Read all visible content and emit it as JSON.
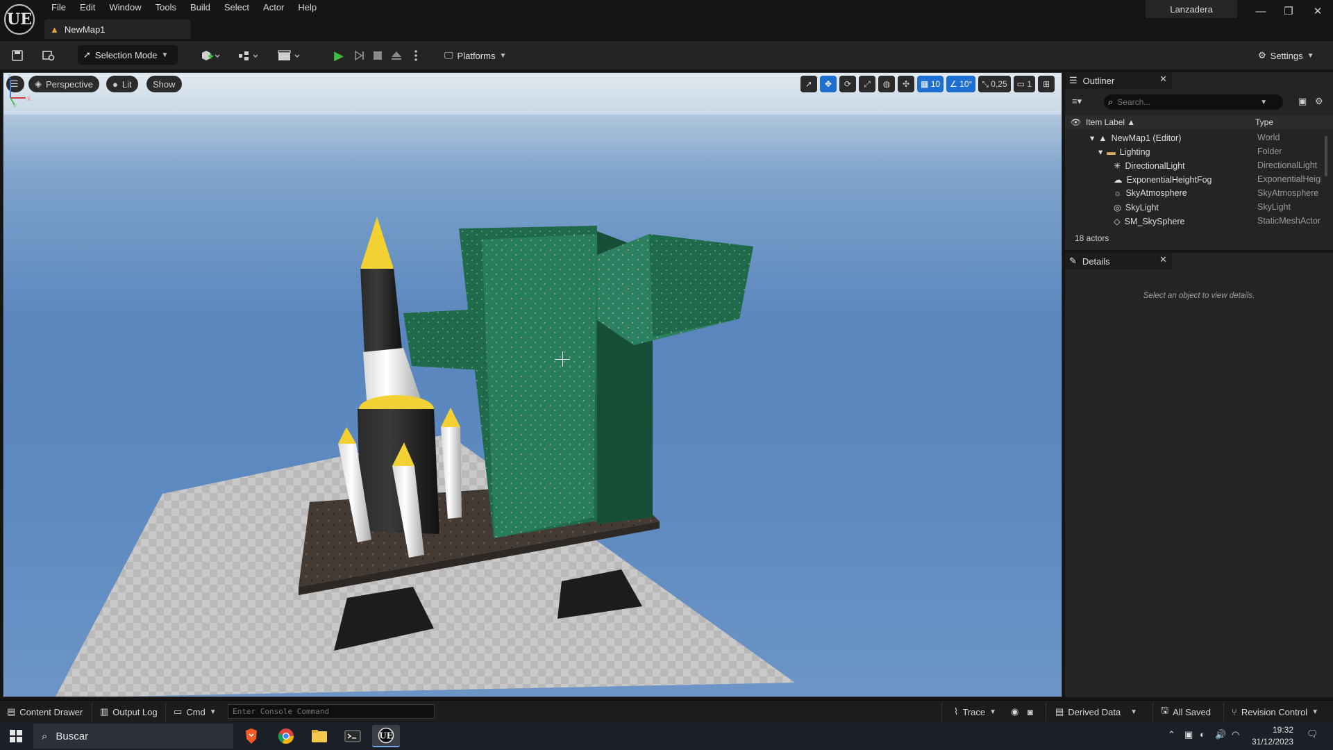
{
  "app": {
    "logo": "UE",
    "project_name": "Lanzadera",
    "window_buttons": {
      "minimize": "—",
      "restore": "❐",
      "close": "✕"
    }
  },
  "menu": [
    "File",
    "Edit",
    "Window",
    "Tools",
    "Build",
    "Select",
    "Actor",
    "Help"
  ],
  "doc_tab": {
    "label": "NewMap1"
  },
  "toolbar": {
    "selection_mode": "Selection Mode",
    "platforms": "Platforms",
    "settings": "Settings"
  },
  "viewport": {
    "perspective": "Perspective",
    "lit": "Lit",
    "show": "Show",
    "grid_snap": "10",
    "rotation_snap": "10°",
    "scale_snap": "0,25",
    "camera_speed": "1",
    "axis_labels": {
      "z": "z",
      "x": "x",
      "y": "y"
    }
  },
  "outliner": {
    "title": "Outliner",
    "search_placeholder": "Search...",
    "col_label": "Item Label ▲",
    "col_type": "Type",
    "rows": [
      {
        "label": "NewMap1 (Editor)",
        "type": "World"
      },
      {
        "label": "Lighting",
        "type": "Folder"
      },
      {
        "label": "DirectionalLight",
        "type": "DirectionalLight"
      },
      {
        "label": "ExponentialHeightFog",
        "type": "ExponentialHeightFog"
      },
      {
        "label": "SkyAtmosphere",
        "type": "SkyAtmosphere"
      },
      {
        "label": "SkyLight",
        "type": "SkyLight"
      },
      {
        "label": "SM_SkySphere",
        "type": "StaticMeshActor"
      }
    ],
    "actor_count": "18 actors"
  },
  "details": {
    "title": "Details",
    "empty_message": "Select an object to view details."
  },
  "bottombar": {
    "content_drawer": "Content Drawer",
    "output_log": "Output Log",
    "cmd": "Cmd",
    "console_placeholder": "Enter Console Command",
    "trace": "Trace",
    "derived_data": "Derived Data",
    "all_saved": "All Saved",
    "revision_control": "Revision Control"
  },
  "taskbar": {
    "search": "Buscar",
    "time": "19:32",
    "date": "31/12/2023"
  },
  "colors": {
    "accent": "#1e6fd0",
    "play_green": "#3fbf3f",
    "panel_bg": "#242424"
  }
}
